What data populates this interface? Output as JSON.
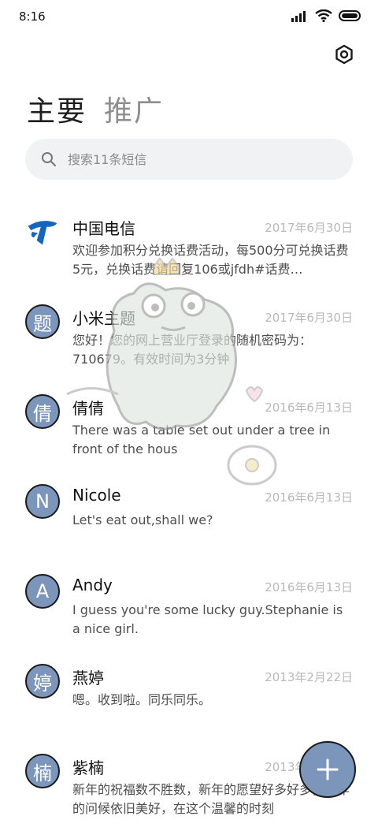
{
  "status_bar": {
    "time": "8:16"
  },
  "tabs": [
    {
      "label": "主要"
    },
    {
      "label": "推广"
    }
  ],
  "search": {
    "placeholder": "搜索11条短信"
  },
  "messages": [
    {
      "name": "中国电信",
      "date": "2017年6月30日",
      "preview": "欢迎参加积分兑换话费活动，每500分可兑换话费5元，兑换话费请回复106或jfdh#话费…",
      "avatar_type": "logo",
      "avatar_char": ""
    },
    {
      "name": "小米主题",
      "date": "2017年6月30日",
      "preview": "您好！您的网上营业厅登录的随机密码为：710679。有效时间为3分钟",
      "avatar_type": "char",
      "avatar_char": "题"
    },
    {
      "name": "倩倩",
      "date": "2016年6月13日",
      "preview": "There was a table set out under a tree in front of the hous",
      "avatar_type": "char",
      "avatar_char": "倩"
    },
    {
      "name": "Nicole",
      "date": "2016年6月13日",
      "preview": "Let's eat out,shall we?",
      "avatar_type": "char",
      "avatar_char": "N"
    },
    {
      "name": "Andy",
      "date": "2016年6月13日",
      "preview": "I guess you're some lucky guy.Stephanie is a nice girl.",
      "avatar_type": "char",
      "avatar_char": "A"
    },
    {
      "name": "燕婷",
      "date": "2013年2月22日",
      "preview": "嗯。收到啦。同乐同乐。",
      "avatar_type": "char",
      "avatar_char": "婷"
    },
    {
      "name": "紫楠",
      "date": "2013年2月22日",
      "preview": "新年的祝福数不胜数，新年的愿望好多好多，新年的问候依旧美好，在这个温馨的时刻",
      "avatar_type": "char",
      "avatar_char": "楠"
    }
  ],
  "colors": {
    "accent": "#7c96bb",
    "date": "#b9b9b9",
    "search_bg": "#f1f2f4",
    "telecom_blue": "#1565c0"
  },
  "icons": {
    "settings": "gear-icon",
    "search": "search-icon",
    "fab": "plus-icon"
  }
}
